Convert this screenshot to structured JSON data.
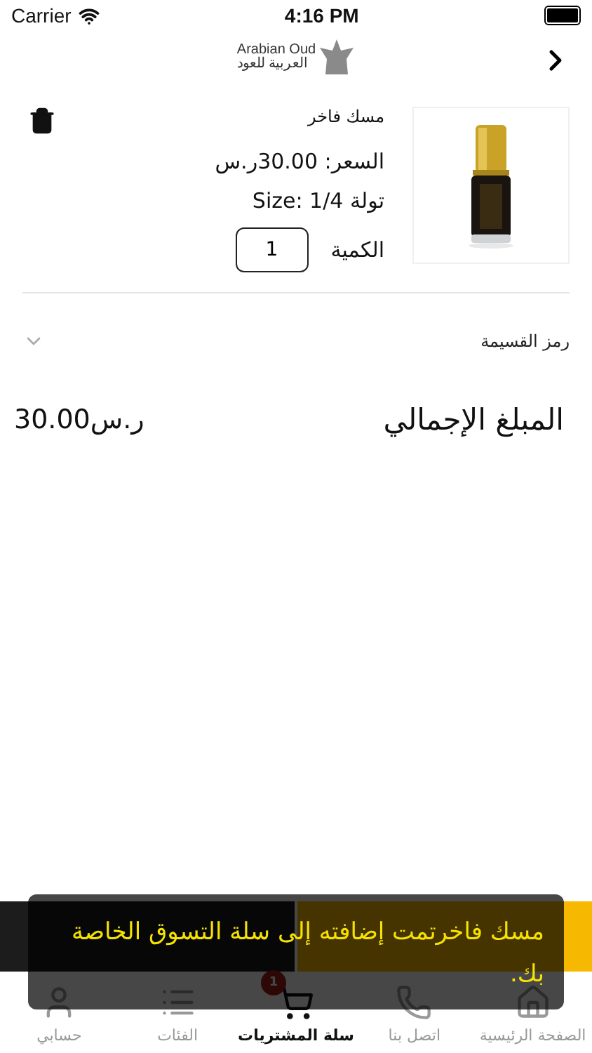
{
  "status_bar": {
    "carrier": "Carrier",
    "time": "4:16 PM"
  },
  "header": {
    "logo_latin": "Arabian Oud",
    "logo_arabic": "العربية للعود"
  },
  "cart_items": [
    {
      "name": "مسك فاخر",
      "price": "السعر: 30.00ر.س",
      "size": "تولة Size: 1/4",
      "quantity_label": "الكمية",
      "quantity": "1"
    }
  ],
  "coupon": {
    "label": "رمز القسيمة",
    "expanded": false
  },
  "total": {
    "label": "المبلغ الإجمالي",
    "amount": "30.00ر.س"
  },
  "toast": {
    "message": "مسك فاخرتمت إضافته إلى سلة التسوق الخاصة بك."
  },
  "tabs": [
    {
      "kind": "home",
      "label": "الصفحة الرئيسية",
      "selected": false
    },
    {
      "kind": "contact",
      "label": "اتصل بنا",
      "selected": false
    },
    {
      "kind": "cart",
      "label": "سلة المشتريات",
      "selected": true,
      "badge": "1"
    },
    {
      "kind": "categories",
      "label": "الفئات",
      "selected": false
    },
    {
      "kind": "account",
      "label": "حسابي",
      "selected": false
    }
  ]
}
